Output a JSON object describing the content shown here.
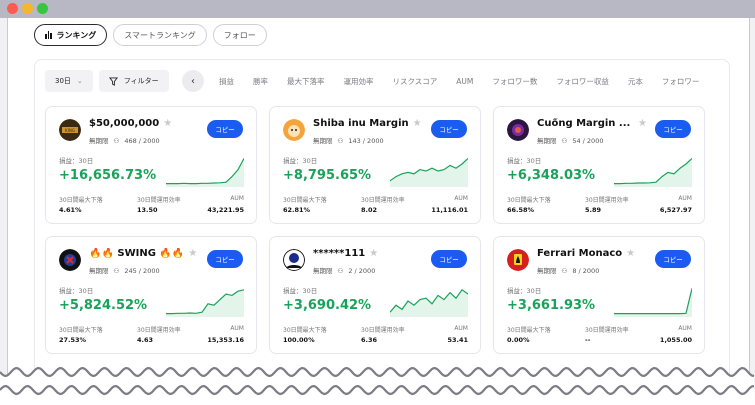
{
  "tabs": [
    {
      "label": "ランキング",
      "active": true
    },
    {
      "label": "スマートランキング",
      "active": false
    },
    {
      "label": "フォロー",
      "active": false
    }
  ],
  "filters": {
    "period": "30日",
    "filter_label": "フィルター"
  },
  "sort_items": [
    "損益",
    "勝率",
    "最大下落率",
    "運用効率",
    "リスクスコア",
    "AUM",
    "フォロワー数",
    "フォロワー収益",
    "元本",
    "フォロワー"
  ],
  "labels": {
    "copy": "コピー",
    "pl_label": "損益：30日",
    "stat1": "30日間最大下落",
    "stat2": "30日間運用効率",
    "stat3": "AUM",
    "term": "無期限"
  },
  "cards": [
    {
      "name": "$50,000,000",
      "followers": "468 / 2000",
      "pl": "+16,656.73%",
      "dd": "4.61%",
      "eff": "13.50",
      "aum": "43,221.95",
      "spark": [
        0.05,
        0.05,
        0.05,
        0.06,
        0.05,
        0.05,
        0.06,
        0.06,
        0.07,
        0.08,
        0.1,
        0.3,
        0.55,
        0.95
      ]
    },
    {
      "name": "Shiba inu Margin",
      "followers": "143 / 2000",
      "pl": "+8,795.65%",
      "dd": "62.81%",
      "eff": "8.02",
      "aum": "11,116.01",
      "spark": [
        0.15,
        0.3,
        0.4,
        0.45,
        0.4,
        0.55,
        0.5,
        0.6,
        0.5,
        0.55,
        0.7,
        0.6,
        0.75,
        0.95
      ]
    },
    {
      "name": "Cuồng Margin ...",
      "followers": "54 / 2000",
      "pl": "+6,348.03%",
      "dd": "66.58%",
      "eff": "5.89",
      "aum": "6,527.97",
      "spark": [
        0.05,
        0.05,
        0.06,
        0.06,
        0.07,
        0.07,
        0.08,
        0.1,
        0.3,
        0.45,
        0.4,
        0.6,
        0.75,
        0.95
      ]
    },
    {
      "name": "🔥🔥 SWING 🔥🔥",
      "followers": "245 / 2000",
      "pl": "+5,824.52%",
      "dd": "27.53%",
      "eff": "4.63",
      "aum": "15,353.16",
      "spark": [
        0.05,
        0.05,
        0.06,
        0.06,
        0.07,
        0.06,
        0.1,
        0.4,
        0.35,
        0.55,
        0.75,
        0.7,
        0.85,
        0.9
      ]
    },
    {
      "name": "******111",
      "followers": "2 / 2000",
      "pl": "+3,690.42%",
      "dd": "100.00%",
      "eff": "6.36",
      "aum": "53.41",
      "spark": [
        0.1,
        0.35,
        0.2,
        0.5,
        0.35,
        0.55,
        0.6,
        0.4,
        0.7,
        0.55,
        0.8,
        0.6,
        0.9,
        0.75
      ]
    },
    {
      "name": "Ferrari Monaco",
      "followers": "8 / 2000",
      "pl": "+3,661.93%",
      "dd": "0.00%",
      "eff": "--",
      "aum": "1,055.00",
      "spark": [
        0.05,
        0.05,
        0.05,
        0.05,
        0.05,
        0.05,
        0.05,
        0.05,
        0.05,
        0.05,
        0.05,
        0.05,
        0.06,
        0.95
      ]
    }
  ],
  "colors": {
    "accent": "#1a5cf0",
    "profit": "#18a35a"
  },
  "icons": [
    "bar-chart-icon",
    "filter-icon",
    "chevron-down-icon",
    "chevron-left-icon",
    "star-icon",
    "user-icon"
  ]
}
